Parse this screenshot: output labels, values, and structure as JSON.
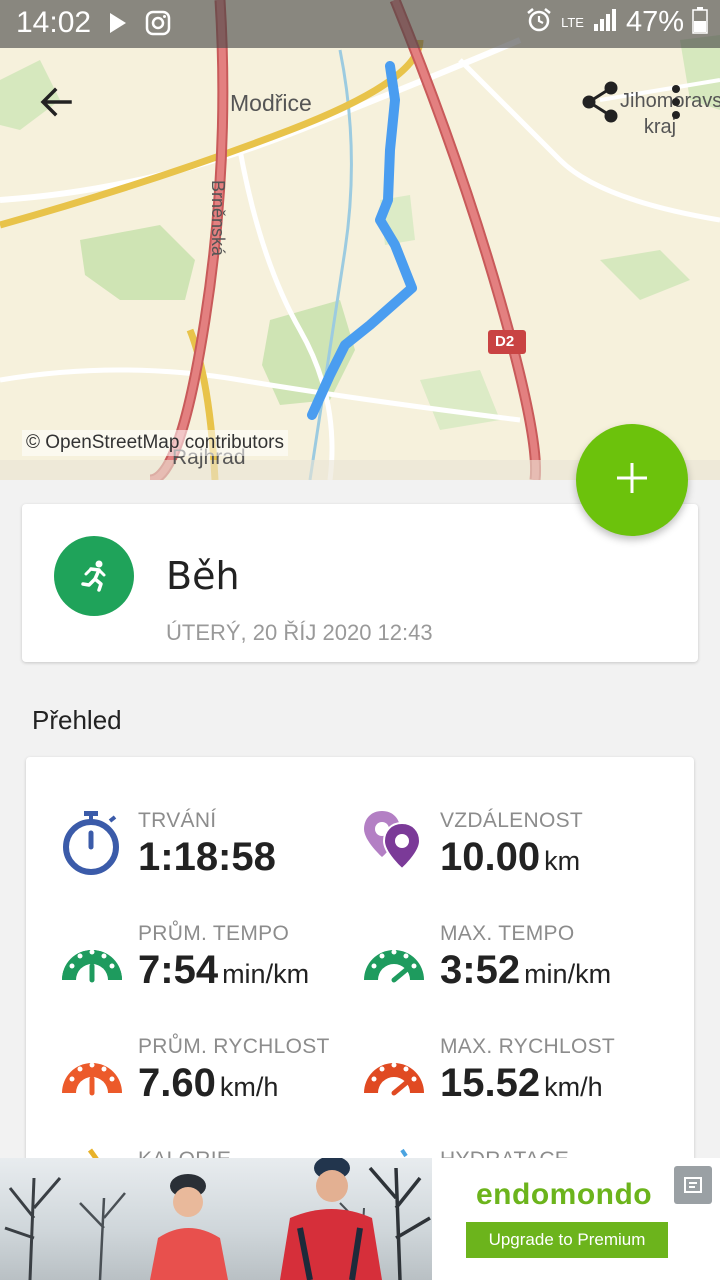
{
  "status_bar": {
    "time": "14:02",
    "network": "LTE",
    "battery": "47%"
  },
  "map": {
    "labels": {
      "town1": "Modřice",
      "street": "Brněnská",
      "region": "Jihomoravský kraj",
      "town2": "Rajhrad",
      "road": "D2"
    },
    "credit": "© OpenStreetMap contributors",
    "route_color": "#4a9df0"
  },
  "toolbar": {
    "back_icon": "arrow-left-icon",
    "share_icon": "share-icon",
    "more_icon": "more-vertical-icon"
  },
  "fab": {
    "icon": "plus-icon",
    "color": "#6cc20c"
  },
  "activity": {
    "sport": "Běh",
    "date": "ÚTERÝ, 20 ŘÍJ 2020 12:43",
    "icon": "running-icon",
    "color": "#1fa35a"
  },
  "overview": {
    "title": "Přehled",
    "metrics": [
      {
        "label": "TRVÁNÍ",
        "value": "1:18:58",
        "unit": "",
        "icon": "stopwatch-icon"
      },
      {
        "label": "VZDÁLENOST",
        "value": "10.00",
        "unit": "km",
        "icon": "location-pins-icon"
      },
      {
        "label": "PRŮM. TEMPO",
        "value": "7:54",
        "unit": "min/km",
        "icon": "gauge-green-icon"
      },
      {
        "label": "MAX. TEMPO",
        "value": "3:52",
        "unit": "min/km",
        "icon": "gauge-green-max-icon"
      },
      {
        "label": "PRŮM. RYCHLOST",
        "value": "7.60",
        "unit": "km/h",
        "icon": "gauge-orange-icon"
      },
      {
        "label": "MAX. RYCHLOST",
        "value": "15.52",
        "unit": "km/h",
        "icon": "gauge-orange-max-icon"
      },
      {
        "label": "KALORIE",
        "value": "",
        "unit": "",
        "icon": "calories-icon"
      },
      {
        "label": "HYDRATACE",
        "value": "",
        "unit": "",
        "icon": "hydration-icon"
      }
    ]
  },
  "ad": {
    "brand": "endomondo",
    "button": "Upgrade to Premium"
  }
}
